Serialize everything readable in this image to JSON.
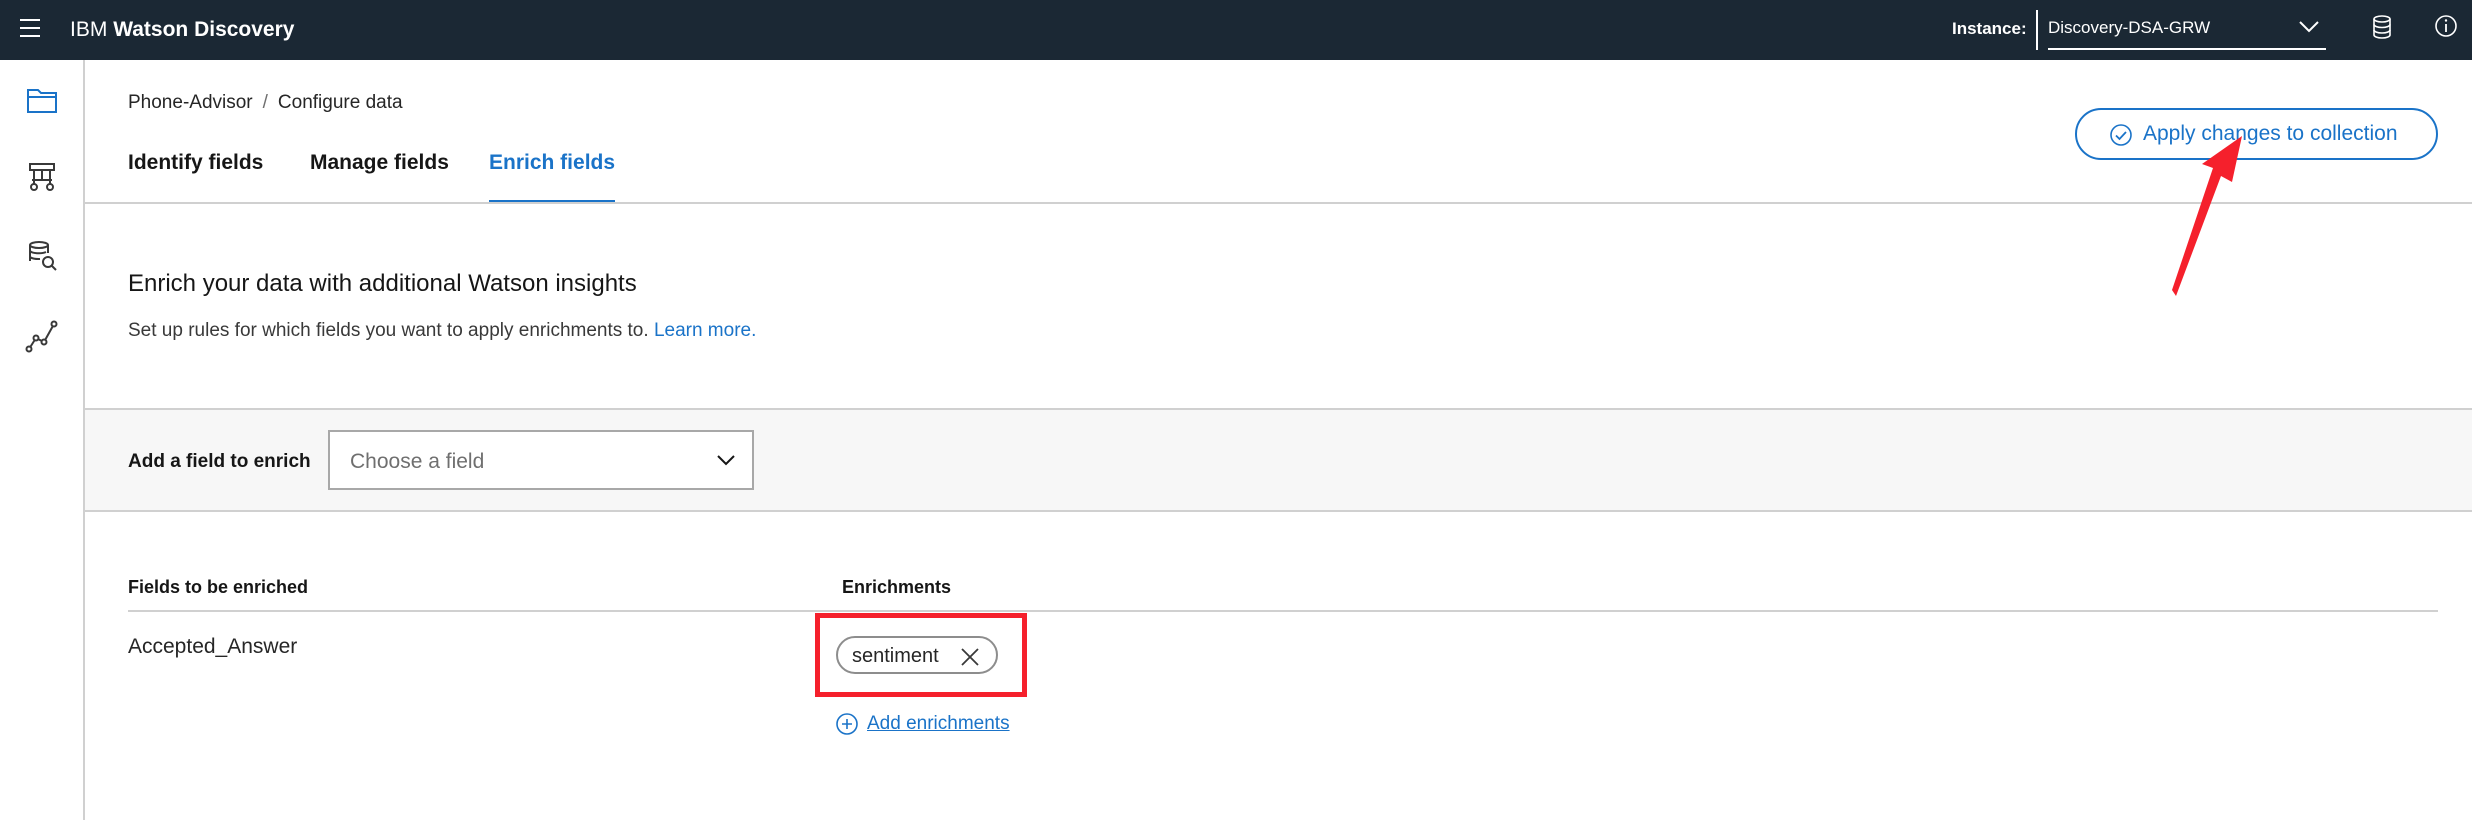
{
  "header": {
    "brand_prefix": "IBM",
    "brand_name": "Watson Discovery",
    "instance_label": "Instance:",
    "instance_value": "Discovery-DSA-GRW"
  },
  "sidebar": {
    "items": [
      {
        "icon": "folder-icon"
      },
      {
        "icon": "hierarchy-icon"
      },
      {
        "icon": "data-search-icon"
      },
      {
        "icon": "analytics-icon"
      }
    ]
  },
  "breadcrumb": {
    "items": [
      "Phone-Advisor",
      "Configure data"
    ],
    "separator": "/"
  },
  "tabs": [
    {
      "label": "Identify fields",
      "active": false
    },
    {
      "label": "Manage fields",
      "active": false
    },
    {
      "label": "Enrich fields",
      "active": true
    }
  ],
  "apply_button": {
    "label": "Apply changes to collection"
  },
  "intro": {
    "heading": "Enrich your data with additional Watson insights",
    "description": "Set up rules for which fields you want to apply enrichments to.",
    "link": "Learn more."
  },
  "add_field": {
    "label": "Add a field to enrich",
    "placeholder": "Choose a field"
  },
  "table": {
    "columns": [
      "Fields to be enriched",
      "Enrichments"
    ],
    "rows": [
      {
        "field": "Accepted_Answer",
        "enrichments": [
          "sentiment"
        ]
      }
    ],
    "add_enrichments_label": "Add enrichments"
  },
  "colors": {
    "header_bg": "#1b2834",
    "accent": "#1a73c8",
    "annotation": "#f5202c"
  }
}
